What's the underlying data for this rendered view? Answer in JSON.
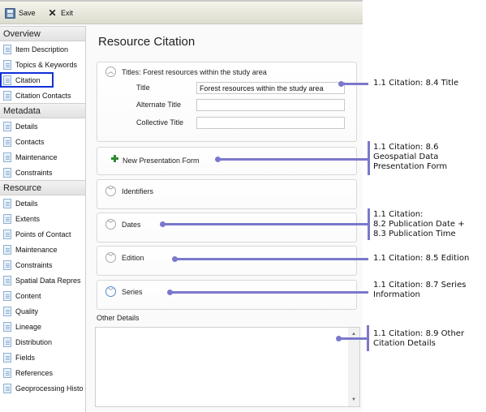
{
  "toolbar": {
    "save_label": "Save",
    "exit_label": "Exit"
  },
  "sidebar": {
    "sections": [
      {
        "title": "Overview",
        "items": [
          "Item Description",
          "Topics & Keywords",
          "Citation",
          "Citation Contacts"
        ]
      },
      {
        "title": "Metadata",
        "items": [
          "Details",
          "Contacts",
          "Maintenance",
          "Constraints"
        ]
      },
      {
        "title": "Resource",
        "items": [
          "Details",
          "Extents",
          "Points of Contact",
          "Maintenance",
          "Constraints",
          "Spatial Data Repres",
          "Content",
          "Quality",
          "Lineage",
          "Distribution",
          "Fields",
          "References",
          "Geoprocessing Histo"
        ]
      }
    ],
    "selected": "Citation"
  },
  "main": {
    "title": "Resource Citation",
    "titles_panel": {
      "header": "Titles:  Forest resources within the study area",
      "fields": [
        {
          "label": "Title",
          "value": "Forest resources within the study area"
        },
        {
          "label": "Alternate Title",
          "value": ""
        },
        {
          "label": "Collective Title",
          "value": ""
        }
      ]
    },
    "new_presentation_form_label": "New Presentation Form",
    "panels": [
      {
        "label": "Identifiers"
      },
      {
        "label": "Dates"
      },
      {
        "label": "Edition"
      },
      {
        "label": "Series"
      }
    ],
    "other_details_label": "Other Details",
    "other_details_value": ""
  },
  "callouts": [
    {
      "text": "1.1 Citation: 8.4 Title"
    },
    {
      "text": "1.1 Citation: 8.6\nGeospatial Data\nPresentation Form"
    },
    {
      "text": "1.1 Citation:\n8.2 Publication Date +\n8.3 Publication Time"
    },
    {
      "text": "1.1 Citation: 8.5 Edition"
    },
    {
      "text": "1.1 Citation: 8.7 Series\nInformation"
    },
    {
      "text": "1.1 Citation: 8.9 Other\nCitation Details"
    }
  ],
  "colors": {
    "callout": "#7b78cc",
    "selection_outline": "#1030d8",
    "add_icon": "#2f8a2f"
  }
}
